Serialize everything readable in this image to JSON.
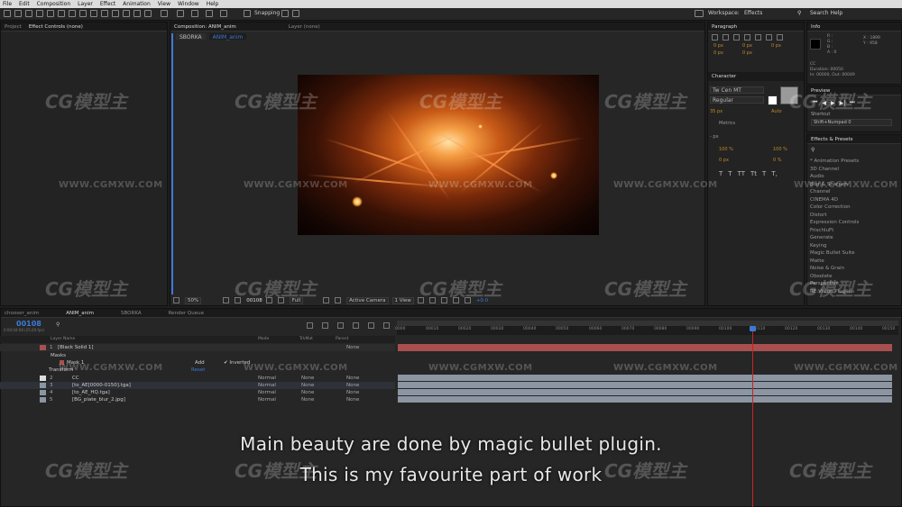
{
  "menu": [
    "File",
    "Edit",
    "Composition",
    "Layer",
    "Effect",
    "Animation",
    "View",
    "Window",
    "Help"
  ],
  "toolbar": {
    "snapping": "Snapping",
    "workspace_label": "Workspace:",
    "workspace_value": "Effects",
    "search_placeholder": "Search Help"
  },
  "left_tabs": {
    "project": "Project",
    "effect_controls": "Effect Controls (none)"
  },
  "comp_panel": {
    "comp_tab": "Composition: ANIM_anim",
    "layer_tab": "Layer (none)",
    "sub_tabs": [
      "SBORKA",
      "ANIM_anim"
    ]
  },
  "viewer_footer": {
    "zoom": "50%",
    "timecode": "00108",
    "resolution": "Full",
    "camera": "Active Camera",
    "views": "1 View",
    "exposure": "+0.0"
  },
  "paragraph": {
    "title": "Paragraph",
    "fields": [
      "0 px",
      "0 px",
      "0 px",
      "0 px",
      "0 px"
    ]
  },
  "character": {
    "title": "Character",
    "font": "Tw Cen MT",
    "style": "Regular",
    "size": "35 px",
    "leading": "Auto",
    "tracking": "Metrics",
    "scale_v": "100 %",
    "scale_h": "100 %",
    "baseline": "0 px",
    "tsume": "0 %",
    "unit": "- px",
    "glyphs": [
      "T",
      "T",
      "TT",
      "Tt",
      "T",
      "T,"
    ]
  },
  "info": {
    "title": "Info",
    "x": "X : 1899",
    "y": "Y : 958",
    "r": "R :",
    "g": "G :",
    "b": "B :",
    "a": "A : 0",
    "layer": "CC",
    "duration": "Duration: 00050",
    "inout": "In: 00000, Out: 00049"
  },
  "preview": {
    "title": "Preview",
    "shortcut_label": "Shortcut",
    "shortcut_value": "Shift+Numpad 0"
  },
  "effects_presets": {
    "title": "Effects & Presets",
    "items": [
      "* Animation Presets",
      "3D Channel",
      "Audio",
      "Blur & Sharpen",
      "Channel",
      "CINEMA 4D",
      "Color Correction",
      "Distort",
      "Expression Controls",
      "FrischluFt",
      "Generate",
      "Keying",
      "Magic Bullet Suite",
      "Matte",
      "Noise & Grain",
      "Obsolete",
      "Perspective",
      "RE:Vision Plug-ins"
    ]
  },
  "timeline": {
    "tabs": [
      "chooser_anim",
      "ANIM_anim",
      "SBORKA",
      "Render Queue"
    ],
    "timecode": "00108",
    "timecode_sub": "0:00:04:08 (25.00 fps)",
    "col_layer_name": "Layer Name",
    "col_mode": "Mode",
    "col_trkmat": "TrkMat",
    "col_parent": "Parent",
    "layers": [
      {
        "num": "1",
        "name": "[Black Solid 1]",
        "mode": "",
        "trkmat": "",
        "parent": "None"
      },
      {
        "num": "2",
        "name": "CC",
        "mode": "Normal",
        "trkmat": "None",
        "parent": "None"
      },
      {
        "num": "3",
        "name": "[to_AE[0000-0150].tga]",
        "mode": "Normal",
        "trkmat": "None",
        "parent": "None"
      },
      {
        "num": "4",
        "name": "[to_AE_HQ.tga]",
        "mode": "Normal",
        "trkmat": "None",
        "parent": "None"
      },
      {
        "num": "5",
        "name": "[BG_plate_blur_2.jpg]",
        "mode": "Normal",
        "trkmat": "None",
        "parent": "None"
      }
    ],
    "masks_label": "Masks",
    "mask1_label": "Mask 1",
    "add_label": "Add",
    "inverted_label": "Inverted",
    "transform_label": "Transform",
    "reset_label": "Reset",
    "ruler": [
      "0000",
      "00010",
      "00020",
      "00030",
      "00040",
      "00050",
      "00060",
      "00070",
      "00080",
      "00090",
      "00100",
      "00110",
      "00120",
      "00130",
      "00140",
      "00150"
    ]
  },
  "subtitles": [
    "Main beauty are done by magic bullet plugin.",
    "This is my favourite part of work"
  ],
  "watermark": {
    "logo": "CG模型主",
    "url": "WWW.CGMXW.COM"
  },
  "colors": {
    "accent_blue": "#3d7ad6",
    "red_layer": "#a85050",
    "gray_layer": "#8c95a2",
    "playhead": "#cc2222"
  }
}
